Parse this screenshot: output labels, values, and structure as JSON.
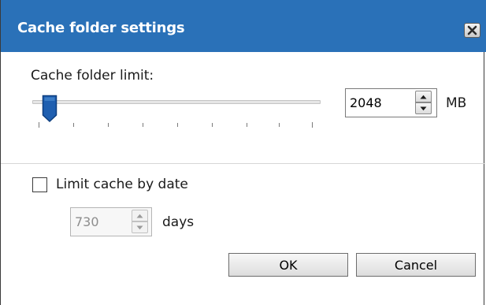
{
  "dialog": {
    "title": "Cache folder settings"
  },
  "cache_limit": {
    "label": "Cache folder limit:",
    "value": "2048",
    "unit": "MB",
    "slider_fraction": 0.05
  },
  "date_limit": {
    "checkbox_label": "Limit cache by date",
    "checked": false,
    "value": "730",
    "unit": "days",
    "enabled": false
  },
  "buttons": {
    "ok_label": "OK",
    "cancel_label": "Cancel"
  },
  "icons": {
    "close": "close-icon",
    "spin_up": "chevron-up-icon",
    "spin_down": "chevron-down-icon"
  },
  "colors": {
    "titlebar": "#2a71b8",
    "slider_thumb": "#1f5fb0"
  }
}
